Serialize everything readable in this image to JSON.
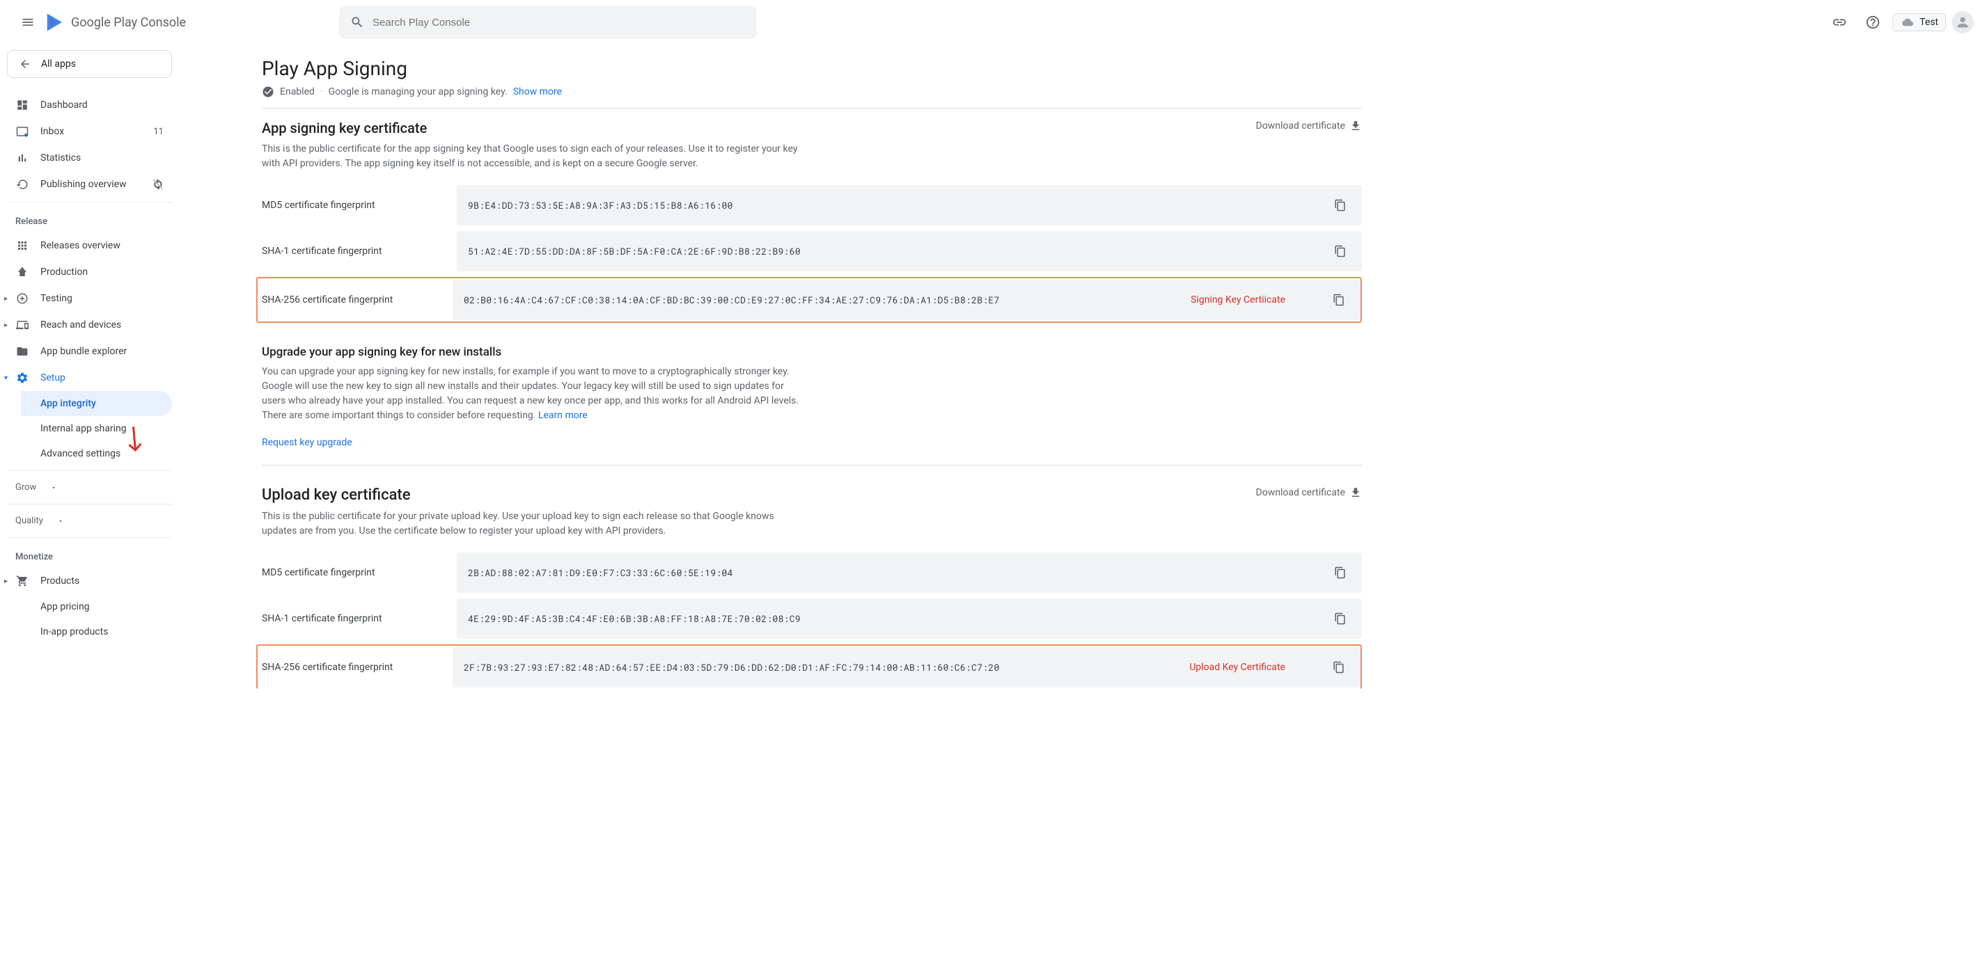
{
  "header": {
    "logo": "Google Play Console",
    "search_placeholder": "Search Play Console",
    "app_name": "Test"
  },
  "sidebar": {
    "all_apps": "All apps",
    "items": [
      {
        "label": "Dashboard"
      },
      {
        "label": "Inbox",
        "badge": "11"
      },
      {
        "label": "Statistics"
      },
      {
        "label": "Publishing overview"
      }
    ],
    "release_section": "Release",
    "release_items": [
      {
        "label": "Releases overview"
      },
      {
        "label": "Production"
      },
      {
        "label": "Testing"
      },
      {
        "label": "Reach and devices"
      },
      {
        "label": "App bundle explorer"
      },
      {
        "label": "Setup"
      }
    ],
    "setup_sub": [
      {
        "label": "App integrity"
      },
      {
        "label": "Internal app sharing"
      },
      {
        "label": "Advanced settings"
      }
    ],
    "grow_section": "Grow",
    "quality_section": "Quality",
    "monetize_section": "Monetize",
    "monetize_items": [
      {
        "label": "Products"
      },
      {
        "label": "App pricing"
      },
      {
        "label": "In-app products"
      }
    ]
  },
  "page": {
    "title": "Play App Signing",
    "status_enabled": "Enabled",
    "status_desc": "Google is managing your app signing key.",
    "show_more": "Show more"
  },
  "signing": {
    "title": "App signing key certificate",
    "download": "Download certificate",
    "desc": "This is the public certificate for the app signing key that Google uses to sign each of your releases. Use it to register your key with API providers. The app signing key itself is not accessible, and is kept on a secure Google server.",
    "md5_label": "MD5 certificate fingerprint",
    "md5_value": "9B:E4:DD:73:53:5E:A8:9A:3F:A3:D5:15:B8:A6:16:00",
    "sha1_label": "SHA-1 certificate fingerprint",
    "sha1_value": "51:A2:4E:7D:55:DD:DA:8F:5B:DF:5A:F0:CA:2E:6F:9D:B8:22:B9:60",
    "sha256_label": "SHA-256 certificate fingerprint",
    "sha256_value": "02:B0:16:4A:C4:67:CF:C0:38:14:0A:CF:BD:BC:39:00:CD:E9:27:0C:FF:34:AE:27:C9:76:DA:A1:D5:B8:2B:E7",
    "annotation": "Signing Key Certiicate"
  },
  "upgrade": {
    "title": "Upgrade your app signing key for new installs",
    "desc": "You can upgrade your app signing key for new installs, for example if you want to move to a cryptographically stronger key. Google will use the new key to sign all new installs and their updates. Your legacy key will still be used to sign updates for users who already have your app installed. You can request a new key once per app, and this works for all Android API levels. There are some important things to consider before requesting.",
    "learn_more": "Learn more",
    "request": "Request key upgrade"
  },
  "upload": {
    "title": "Upload key certificate",
    "download": "Download certificate",
    "desc": "This is the public certificate for your private upload key. Use your upload key to sign each release so that Google knows updates are from you. Use the certificate below to register your upload key with API providers.",
    "md5_label": "MD5 certificate fingerprint",
    "md5_value": "2B:AD:88:02:A7:81:D9:E0:F7:C3:33:6C:60:5E:19:04",
    "sha1_label": "SHA-1 certificate fingerprint",
    "sha1_value": "4E:29:9D:4F:A5:3B:C4:4F:E0:6B:3B:A8:FF:18:A8:7E:70:02:08:C9",
    "sha256_label": "SHA-256 certificate fingerprint",
    "sha256_value": "2F:7B:93:27:93:E7:82:48:AD:64:57:EE:D4:03:5D:79:D6:DD:62:D0:D1:AF:FC:79:14:00:AB:11:60:C6:C7:20",
    "annotation": "Upload Key Certificate"
  }
}
